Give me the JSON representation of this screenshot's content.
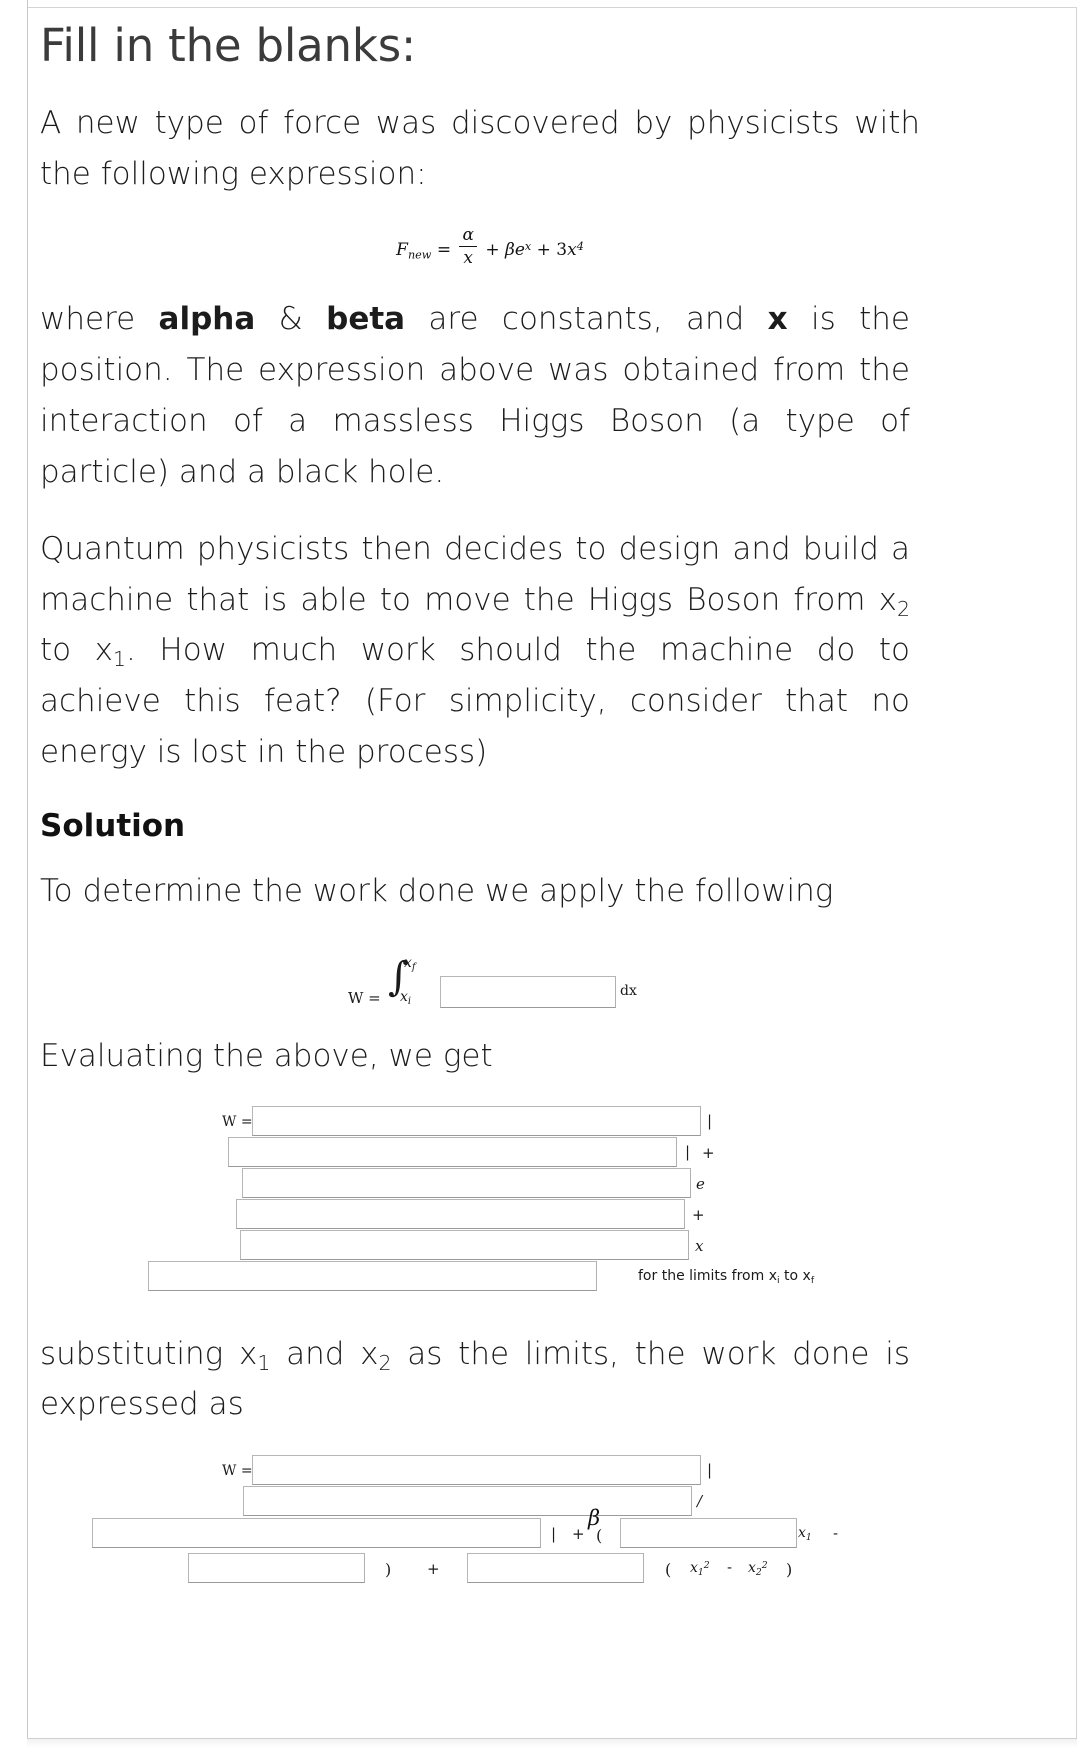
{
  "document": {
    "title": "Fill in the blanks:",
    "paragraphs": {
      "intro_a": "A new type of force was discovered by physicists with",
      "intro_b": "the following expression:",
      "where_pre": "where ",
      "where_alpha": "alpha",
      "where_amp": " & ",
      "where_beta": "beta",
      "where_mid": " are constants, and ",
      "where_x": "x",
      "where_post": " is the position. The expression above was obtained from the interaction of a massless Higgs Boson (a type of particle) and a black hole.",
      "quantum_pre": "Quantum physicists then decides to design and build a machine that is able to move the Higgs Boson from x",
      "quantum_sub1": "2",
      "quantum_mid": " to x",
      "quantum_sub2": "1",
      "quantum_post": ". How much work should the machine do to achieve this feat? (For simplicity, consider that no energy is lost in the process)",
      "solution_heading": "Solution",
      "apply_line": "To determine the work done we apply the following",
      "evaluating_line": "Evaluating the above, we get",
      "substituting_pre": "substituting x",
      "substituting_sub1": "1",
      "substituting_mid": " and x",
      "substituting_sub2": "2",
      "substituting_post": " as the limits, the work done is expressed as"
    },
    "force_equation": {
      "lhs": "F",
      "lhs_sub": "new",
      "equals": "=",
      "frac_num": "α",
      "frac_den": "x",
      "plus1": "+",
      "beta": "β",
      "e": "e",
      "e_sup": "x",
      "plus2": "+",
      "coef": "3",
      "var": "x",
      "var_sup": "4"
    },
    "integral_line": {
      "w_label": "W =",
      "integral_sign": "∫",
      "upper_limit_base": "x",
      "upper_limit_sub": "f",
      "lower_limit_base": "x",
      "lower_limit_sub": "i",
      "dx_label": "dx",
      "blank_value": "",
      "blank_placeholder": ""
    },
    "evaluating_block": {
      "w_label": "W =",
      "bar1": "|",
      "bar2": "|",
      "plus1": "+",
      "e_char": "e",
      "plus2": "+",
      "x_char": "x",
      "limits_note_pre": "for the limits from x",
      "limits_note_sub1": "i",
      "limits_note_mid": " to x",
      "limits_note_sub2": "f",
      "blanks": [
        "",
        "",
        "",
        "",
        "",
        ""
      ]
    },
    "final_block": {
      "w_label": "W =",
      "bar1": "|",
      "slash": "/",
      "bar2": "|",
      "plus1": "+",
      "beta": "β",
      "paren_open_1": "(",
      "x1_base": "x",
      "x1_sub": "1",
      "minus1": "-",
      "paren_close_1": ")",
      "plus2": "+",
      "paren_open_2": "(",
      "t1_base": "x",
      "t1_sub": "1",
      "t1_sup": "2",
      "minus2": "-",
      "t2_base": "x",
      "t2_sub": "2",
      "t2_sup": "2",
      "paren_close_2": ")",
      "blanks": [
        "",
        "",
        "",
        "",
        "",
        ""
      ]
    }
  },
  "colors": {
    "page_background": "#ffffff",
    "text": "#1a1a1a",
    "title": "#3b3b3b",
    "input_border": "#b6b6b6",
    "frame_rule": "#c9c9c9"
  }
}
